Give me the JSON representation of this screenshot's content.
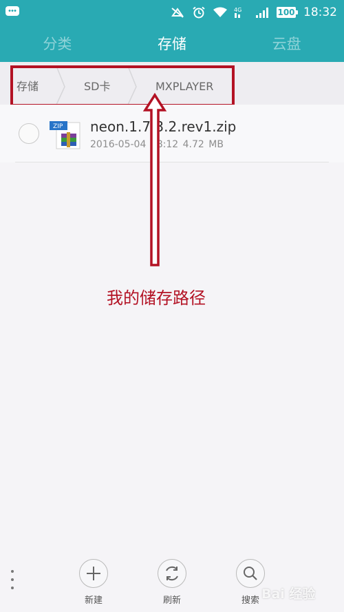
{
  "status_bar": {
    "time": "18:32",
    "battery": "100",
    "icons": [
      "chat-bubble-icon",
      "mute-icon",
      "alarm-icon",
      "wifi-icon",
      "cellular-4g-icon",
      "signal-icon",
      "battery-icon"
    ]
  },
  "tabs": [
    {
      "label": "分类",
      "active": false
    },
    {
      "label": "存储",
      "active": true
    },
    {
      "label": "云盘",
      "active": false
    }
  ],
  "breadcrumb": [
    "存储",
    "SD卡",
    "MXPLAYER"
  ],
  "files": [
    {
      "name": "neon.1.7.3.2.rev1.zip",
      "date": "2016-05-04",
      "time": "18:12",
      "size": "4.72 MB",
      "icon_label": "ZIP"
    }
  ],
  "annotation": {
    "text": "我的储存路径",
    "color": "#b31224"
  },
  "bottom_bar": {
    "new_label": "新建",
    "refresh_label": "刷新",
    "search_label": "搜索"
  },
  "watermark": "Bai 经验",
  "colors": {
    "accent": "#29aab3",
    "annotation_red": "#b31224"
  }
}
